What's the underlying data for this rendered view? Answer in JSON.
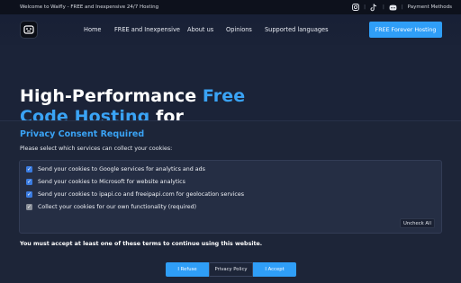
{
  "topbar": {
    "welcome": "Welcome to Waifly - FREE and Inexpensive 24/7 Hosting",
    "payment_methods": "Payment Methods",
    "social_icons": [
      "instagram-icon",
      "tiktok-icon",
      "discord-icon"
    ]
  },
  "nav": {
    "items": [
      "Home",
      "FREE and Inexpensive",
      "About us",
      "Opinions",
      "Supported languages"
    ],
    "cta": "FREE Forever Hosting"
  },
  "hero": {
    "line1_plain": "High-Performance ",
    "line1_accent": "Free",
    "line2_accent": "Code Hosting",
    "line2_plain": " for"
  },
  "consent": {
    "title": "Privacy Consent Required",
    "subtitle": "Please select which services can collect your cookies:",
    "options": [
      {
        "label": "Send your cookies to Google services for analytics and ads",
        "checked": true,
        "disabled": false
      },
      {
        "label": "Send your cookies to Microsoft for website analytics",
        "checked": true,
        "disabled": false
      },
      {
        "label": "Send your cookies to ipapi.co and freeipapi.com for geolocation services",
        "checked": true,
        "disabled": false
      },
      {
        "label": "Collect your cookies for our own functionality (required)",
        "checked": true,
        "disabled": true
      }
    ],
    "uncheck_all": "Uncheck All",
    "warning": "You must accept at least one of these terms to continue using this website.",
    "buttons": {
      "refuse": "I Refuse",
      "policy": "Privacy Policy",
      "accept": "I Accept"
    }
  },
  "colors": {
    "accent": "#2f9ef7",
    "title_accent": "#3aa3f5",
    "background": "#1b2338",
    "topbar": "#0d111c"
  }
}
